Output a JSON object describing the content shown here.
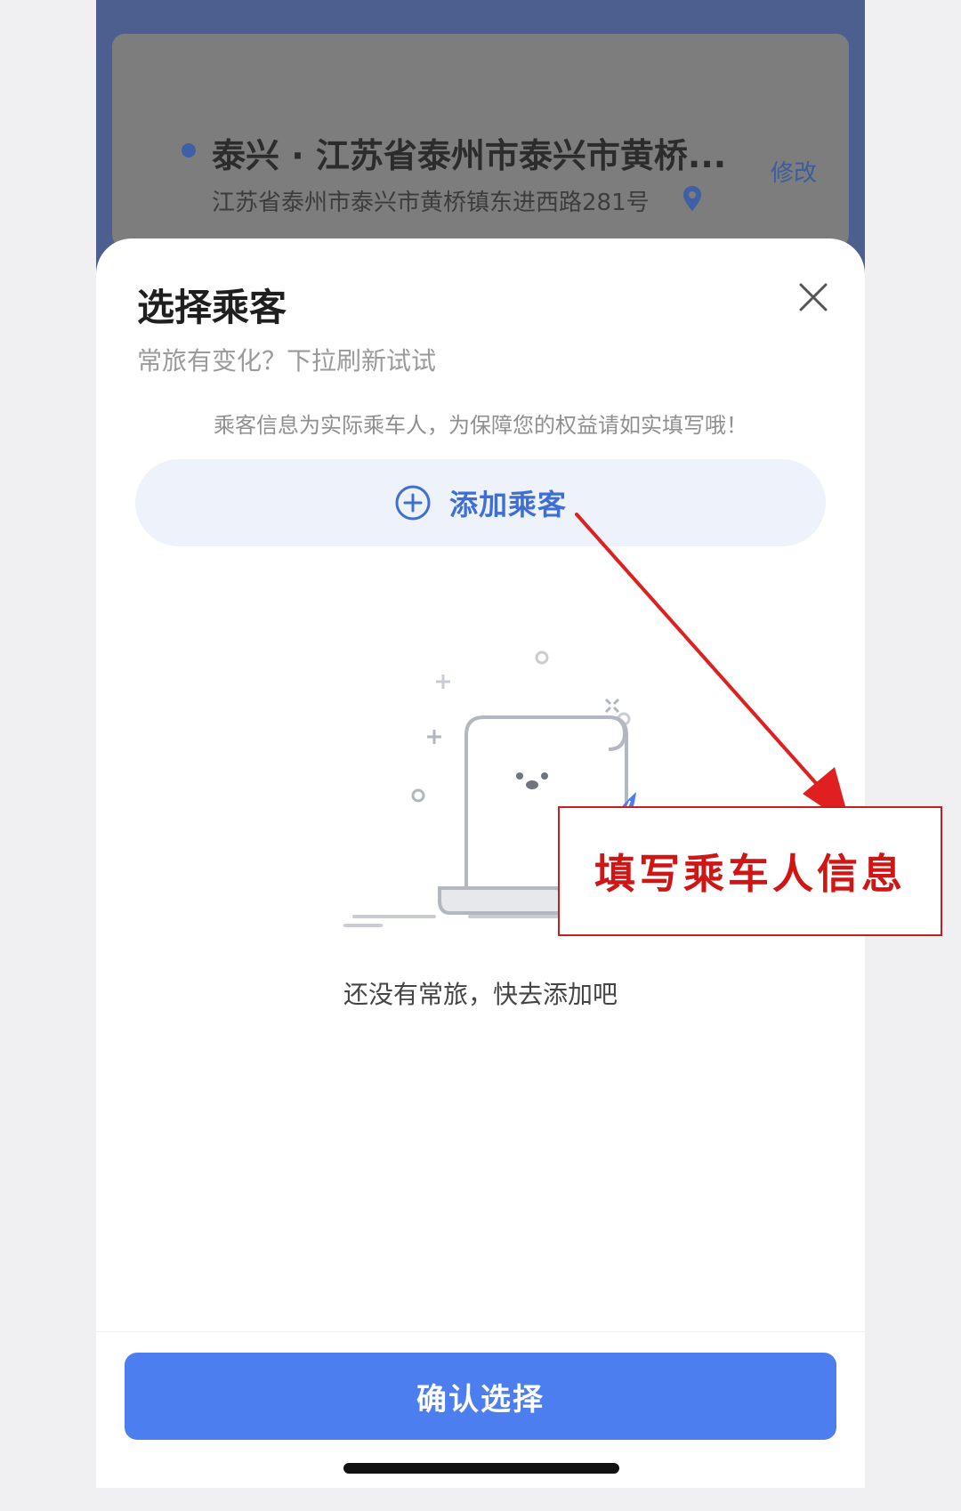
{
  "address_card": {
    "title": "泰兴 · 江苏省泰州市泰兴市黄桥...",
    "subtitle": "江苏省泰州市泰兴市黄桥镇东进西路281号",
    "edit_label": "修改"
  },
  "sheet": {
    "title": "选择乘客",
    "subtitle": "常旅有变化？下拉刷新试试",
    "notice": "乘客信息为实际乘车人，为保障您的权益请如实填写哦！",
    "add_button_label": "添加乘客",
    "empty_text": "还没有常旅，快去添加吧",
    "confirm_label": "确认选择"
  },
  "annotation": {
    "text": "填写乘车人信息",
    "color": "#d01515"
  },
  "colors": {
    "primary": "#4d7ef0",
    "header_bg": "#4d5f8f",
    "add_button_bg": "#eef2fb",
    "add_button_text": "#3e6fd6"
  }
}
